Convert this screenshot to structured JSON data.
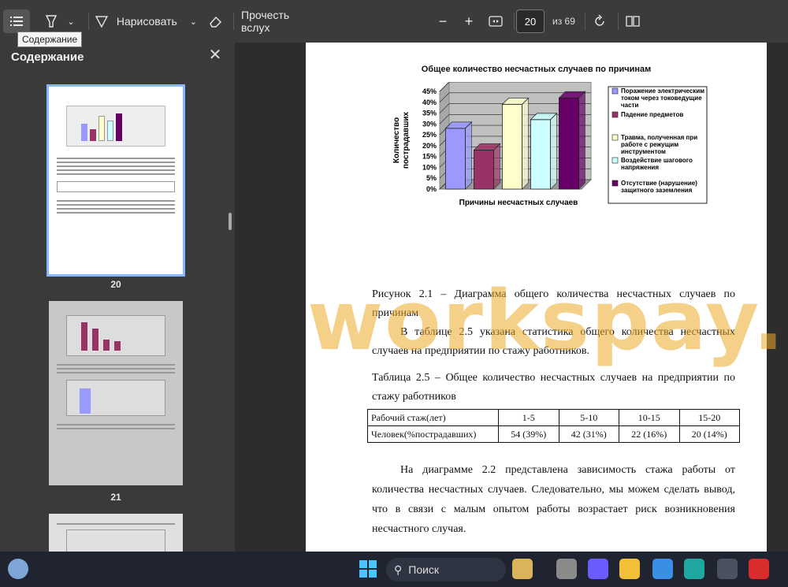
{
  "toolbar": {
    "contents_tooltip": "Содержание",
    "draw_label": "Нарисовать",
    "read_aloud_label": "Прочесть вслух",
    "page_number": "20",
    "page_total": "из 69"
  },
  "sidebar": {
    "title": "Содержание",
    "thumbnails": [
      {
        "label": "20"
      },
      {
        "label": "21"
      }
    ]
  },
  "document": {
    "chart_title": "Общее количество несчастных случаев по причинам",
    "figure_caption": "Рисунок 2.1 – Диаграмма общего количества несчастных случаев по причинам",
    "para1": "В таблице 2.5 указана статистика общего количества несчастных случаев на предприятии по стажу работников.",
    "table_caption": "Таблица 2.5 – Общее количество несчастных случаев на предприятии по стажу работников",
    "table": {
      "header": [
        "Рабочий стаж(лет)",
        "1-5",
        "5-10",
        "10-15",
        "15-20"
      ],
      "row": [
        "Человек(%пострадавших)",
        "54 (39%)",
        "42 (31%)",
        "22 (16%)",
        "20 (14%)"
      ]
    },
    "para2": "На диаграмме 2.2 представлена зависимость стажа работы от количества несчастных случаев. Следовательно, мы можем сделать вывод, что в связи с малым опытом работы возрастает риск возникновения несчастного случая."
  },
  "watermark": "workspay.ru",
  "taskbar": {
    "search_label": "Поиск"
  },
  "chart_data": {
    "type": "bar",
    "title": "Общее количество несчастных случаев по причинам",
    "xlabel": "Причины несчастных случаев",
    "ylabel": "Количество пострадавших",
    "ylim": [
      0,
      45
    ],
    "yticks": [
      "0%",
      "5%",
      "10%",
      "15%",
      "20%",
      "25%",
      "30%",
      "35%",
      "40%",
      "45%"
    ],
    "series": [
      {
        "name": "Поражение электрическим током через токоведущие части",
        "value": 28,
        "color": "#9999ff"
      },
      {
        "name": "Падение предметов",
        "value": 18,
        "color": "#993366"
      },
      {
        "name": "Травма, полученная при работе с режущим инструментом",
        "value": 39,
        "color": "#ffffcc"
      },
      {
        "name": "Воздействие шагового напряжения",
        "value": 32,
        "color": "#ccffff"
      },
      {
        "name": "Отсутствие (нарушение) защитного заземления",
        "value": 42,
        "color": "#660066"
      }
    ],
    "legend_position": "right"
  }
}
